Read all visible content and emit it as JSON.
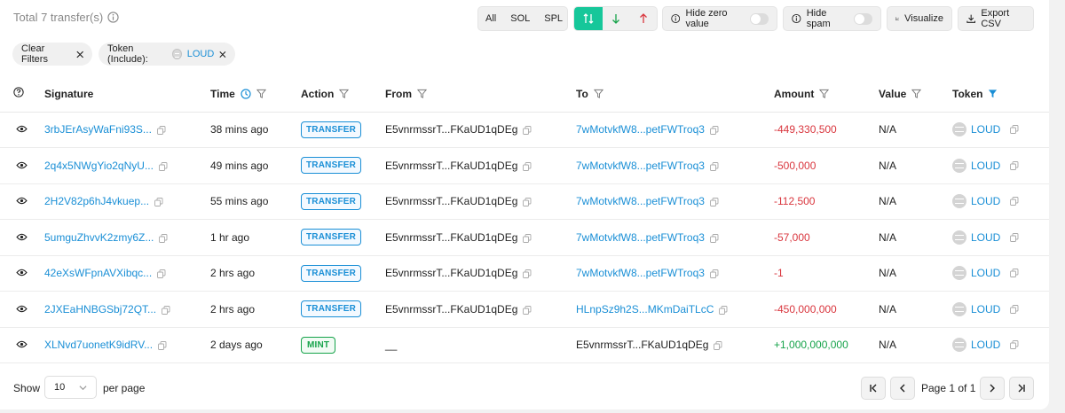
{
  "header": {
    "total_label": "Total 7 transfer(s)",
    "type_filters": [
      "All",
      "SOL",
      "SPL"
    ],
    "hide_zero_label": "Hide zero value",
    "hide_spam_label": "Hide spam",
    "visualize_label": "Visualize",
    "export_label": "Export CSV"
  },
  "filters": {
    "clear_label": "Clear Filters",
    "token_label": "Token (Include):",
    "token_value": "LOUD"
  },
  "columns": {
    "signature": "Signature",
    "time": "Time",
    "action": "Action",
    "from": "From",
    "to": "To",
    "amount": "Amount",
    "value": "Value",
    "token": "Token"
  },
  "rows": [
    {
      "signature": "3rbJErAsyWaFni93S...",
      "time": "38 mins ago",
      "action": "TRANSFER",
      "from": "E5vnrmssrT...FKaUD1qDEg",
      "to": "7wMotvkfW8...petFWTroq3",
      "amount": "-449,330,500",
      "value": "N/A",
      "token": "LOUD"
    },
    {
      "signature": "2q4x5NWgYio2qNyU...",
      "time": "49 mins ago",
      "action": "TRANSFER",
      "from": "E5vnrmssrT...FKaUD1qDEg",
      "to": "7wMotvkfW8...petFWTroq3",
      "amount": "-500,000",
      "value": "N/A",
      "token": "LOUD"
    },
    {
      "signature": "2H2V82p6hJ4vkuep...",
      "time": "55 mins ago",
      "action": "TRANSFER",
      "from": "E5vnrmssrT...FKaUD1qDEg",
      "to": "7wMotvkfW8...petFWTroq3",
      "amount": "-112,500",
      "value": "N/A",
      "token": "LOUD"
    },
    {
      "signature": "5umguZhvvK2zmy6Z...",
      "time": "1 hr ago",
      "action": "TRANSFER",
      "from": "E5vnrmssrT...FKaUD1qDEg",
      "to": "7wMotvkfW8...petFWTroq3",
      "amount": "-57,000",
      "value": "N/A",
      "token": "LOUD"
    },
    {
      "signature": "42eXsWFpnAVXibqc...",
      "time": "2 hrs ago",
      "action": "TRANSFER",
      "from": "E5vnrmssrT...FKaUD1qDEg",
      "to": "7wMotvkfW8...petFWTroq3",
      "amount": "-1",
      "value": "N/A",
      "token": "LOUD"
    },
    {
      "signature": "2JXEaHNBGSbj72QT...",
      "time": "2 hrs ago",
      "action": "TRANSFER",
      "from": "E5vnrmssrT...FKaUD1qDEg",
      "to": "HLnpSz9h2S...MKmDaiTLcC",
      "amount": "-450,000,000",
      "value": "N/A",
      "token": "LOUD"
    },
    {
      "signature": "XLNvd7uonetK9idRV...",
      "time": "2 days ago",
      "action": "MINT",
      "from": "__",
      "to": "E5vnrmssrT...FKaUD1qDEg",
      "amount": "+1,000,000,000",
      "value": "N/A",
      "token": "LOUD"
    }
  ],
  "footer": {
    "show_label": "Show",
    "per_page_value": "10",
    "per_page_label": "per page",
    "page_text": "Page 1 of 1"
  },
  "colors": {
    "accent_green": "#16c79a",
    "link_blue": "#1a8fd6",
    "negative_red": "#d9363e",
    "positive_green": "#16a34a"
  }
}
